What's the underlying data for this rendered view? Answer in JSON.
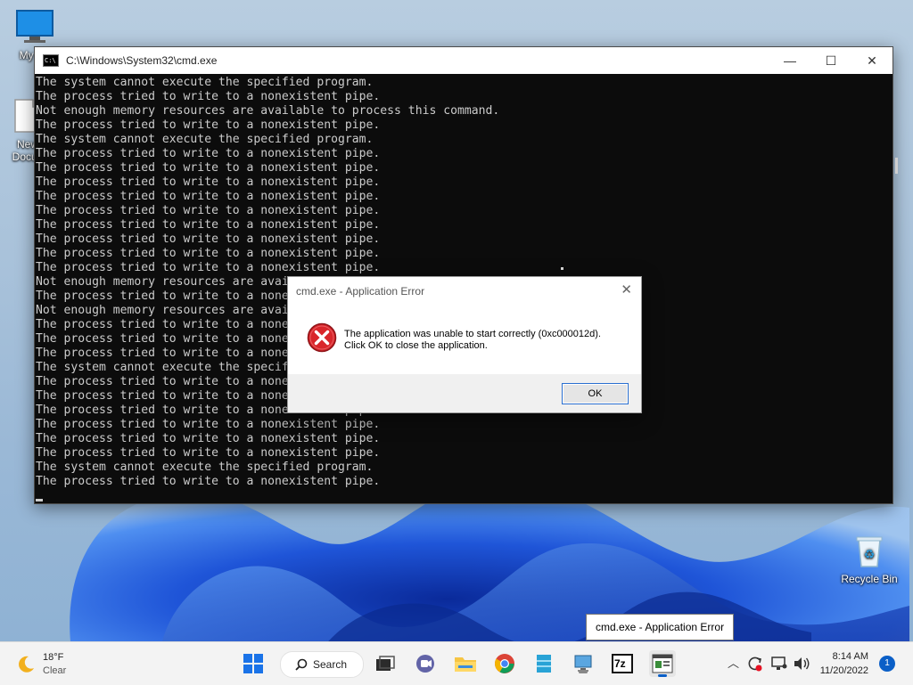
{
  "desktop": {
    "icons": [
      {
        "label": "My Co",
        "icon": "monitor-icon"
      },
      {
        "label": "New\nDocun",
        "icon": "document-icon"
      },
      {
        "label": "Recycle Bin",
        "icon": "recycle-bin-icon"
      }
    ]
  },
  "cmd": {
    "title": "C:\\Windows\\System32\\cmd.exe",
    "icon_text": "C:\\",
    "lines": [
      "The system cannot execute the specified program.",
      "The process tried to write to a nonexistent pipe.",
      "Not enough memory resources are available to process this command.",
      "The process tried to write to a nonexistent pipe.",
      "The system cannot execute the specified program.",
      "The process tried to write to a nonexistent pipe.",
      "The process tried to write to a nonexistent pipe.",
      "The process tried to write to a nonexistent pipe.",
      "The process tried to write to a nonexistent pipe.",
      "The process tried to write to a nonexistent pipe.",
      "The process tried to write to a nonexistent pipe.",
      "The process tried to write to a nonexistent pipe.",
      "The process tried to write to a nonexistent pipe.",
      "The process tried to write to a nonexistent pipe.",
      "Not enough memory resources are available to process this command.",
      "The process tried to write to a nonexistent pipe.",
      "Not enough memory resources are available to process this command.",
      "The process tried to write to a nonexistent pipe.",
      "The process tried to write to a nonexistent pipe.",
      "The process tried to write to a nonexistent pipe.",
      "The system cannot execute the specified program.",
      "The process tried to write to a nonexistent pipe.",
      "The process tried to write to a nonexistent pipe.",
      "The process tried to write to a nonexistent pipe.",
      "The process tried to write to a nonexistent pipe.",
      "The process tried to write to a nonexistent pipe.",
      "The process tried to write to a nonexistent pipe.",
      "The system cannot execute the specified program.",
      "The process tried to write to a nonexistent pipe."
    ],
    "minimize": "—",
    "maximize": "☐",
    "close": "✕"
  },
  "dialog": {
    "title": "cmd.exe - Application Error",
    "message_line1": "The application was unable to start correctly (0xc000012d).",
    "message_line2": "Click OK to close the application.",
    "ok_label": "OK",
    "close": "✕"
  },
  "tooltip": {
    "text": "cmd.exe - Application Error"
  },
  "taskbar": {
    "weather_temp": "18°F",
    "weather_cond": "Clear",
    "search_label": "Search",
    "time": "8:14 AM",
    "date": "11/20/2022",
    "notification_count": "1",
    "sevenzip_label": "7z",
    "accent": "#0b5fc7"
  }
}
